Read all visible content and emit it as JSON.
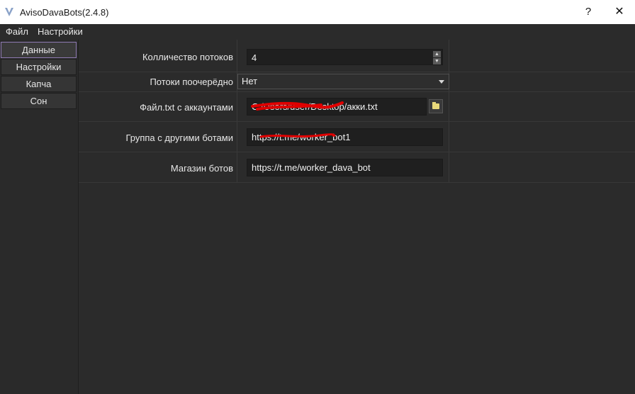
{
  "window": {
    "title": "AvisoDavaBots(2.4.8)",
    "help_glyph": "?",
    "close_glyph": "✕"
  },
  "menu": {
    "file": "Файл",
    "settings": "Настройки"
  },
  "sidebar": {
    "items": [
      {
        "label": "Данные",
        "active": true
      },
      {
        "label": "Настройки",
        "active": false
      },
      {
        "label": "Капча",
        "active": false
      },
      {
        "label": "Сон",
        "active": false
      }
    ]
  },
  "form": {
    "threads": {
      "label": "Колличество потоков",
      "value": "4"
    },
    "sequential": {
      "label": "Потоки поочерёдно",
      "value": "Нет"
    },
    "accounts_file": {
      "label": "Файл.txt с аккаунтами",
      "value": "C:/Users/user/Desktop/акки.txt"
    },
    "bots_group": {
      "label": "Группа с другими ботами",
      "value": "https://t.me/worker_bot1"
    },
    "bots_shop": {
      "label": "Магазин ботов",
      "value": "https://t.me/worker_dava_bot"
    }
  },
  "colors": {
    "background": "#2b2b2b",
    "field": "#1f1f1f",
    "accent_border": "#8f7ab3",
    "redaction": "#e00000"
  },
  "icons": [
    "app-logo-icon",
    "help-icon",
    "close-icon",
    "spin-up-icon",
    "spin-down-icon",
    "dropdown-arrow-icon",
    "folder-icon"
  ]
}
